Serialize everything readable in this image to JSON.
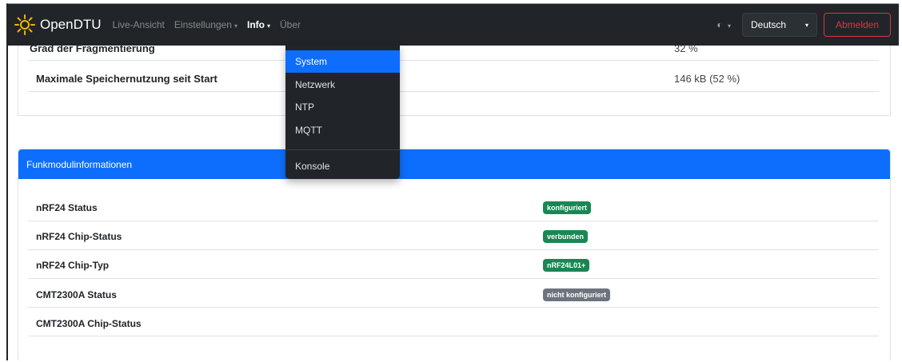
{
  "navbar": {
    "brand": "OpenDTU",
    "links": [
      {
        "label": "Live-Ansicht"
      },
      {
        "label": "Einstellungen",
        "caret": "▾"
      },
      {
        "label": "Info",
        "caret": "▾"
      },
      {
        "label": "Über"
      }
    ],
    "theme_icon": "◐",
    "theme_caret": "▾",
    "language": "Deutsch",
    "language_caret": "▾",
    "logout": "Abmelden"
  },
  "info_menu": {
    "items": [
      "System",
      "Netzwerk",
      "NTP",
      "MQTT"
    ],
    "after_divider": "Konsole",
    "selected": "System"
  },
  "memory_card": {
    "rows": [
      {
        "label": "Grad der Fragmentierung",
        "value": "32 %"
      },
      {
        "label": "Maximale Speichernutzung seit Start",
        "value": "146 kB (52 %)"
      }
    ]
  },
  "radio_card": {
    "title": "Funkmodulinformationen",
    "rows": [
      {
        "label": "nRF24 Status",
        "badge": "konfiguriert",
        "badge_color": "#198754"
      },
      {
        "label": "nRF24 Chip-Status",
        "badge": "verbunden",
        "badge_color": "#198754"
      },
      {
        "label": "nRF24 Chip-Typ",
        "badge": "nRF24L01+",
        "badge_color": "#198754"
      },
      {
        "label": "CMT2300A Status",
        "badge": "nicht konfiguriert",
        "badge_color": "#6c757d"
      },
      {
        "label": "CMT2300A Chip-Status",
        "badge": ""
      }
    ]
  },
  "colors": {
    "navbar": "#212529",
    "primary": "#0d6efd",
    "success": "#198754",
    "secondary": "#6c757d",
    "danger": "#dc3545",
    "sun": "#f0b400"
  }
}
